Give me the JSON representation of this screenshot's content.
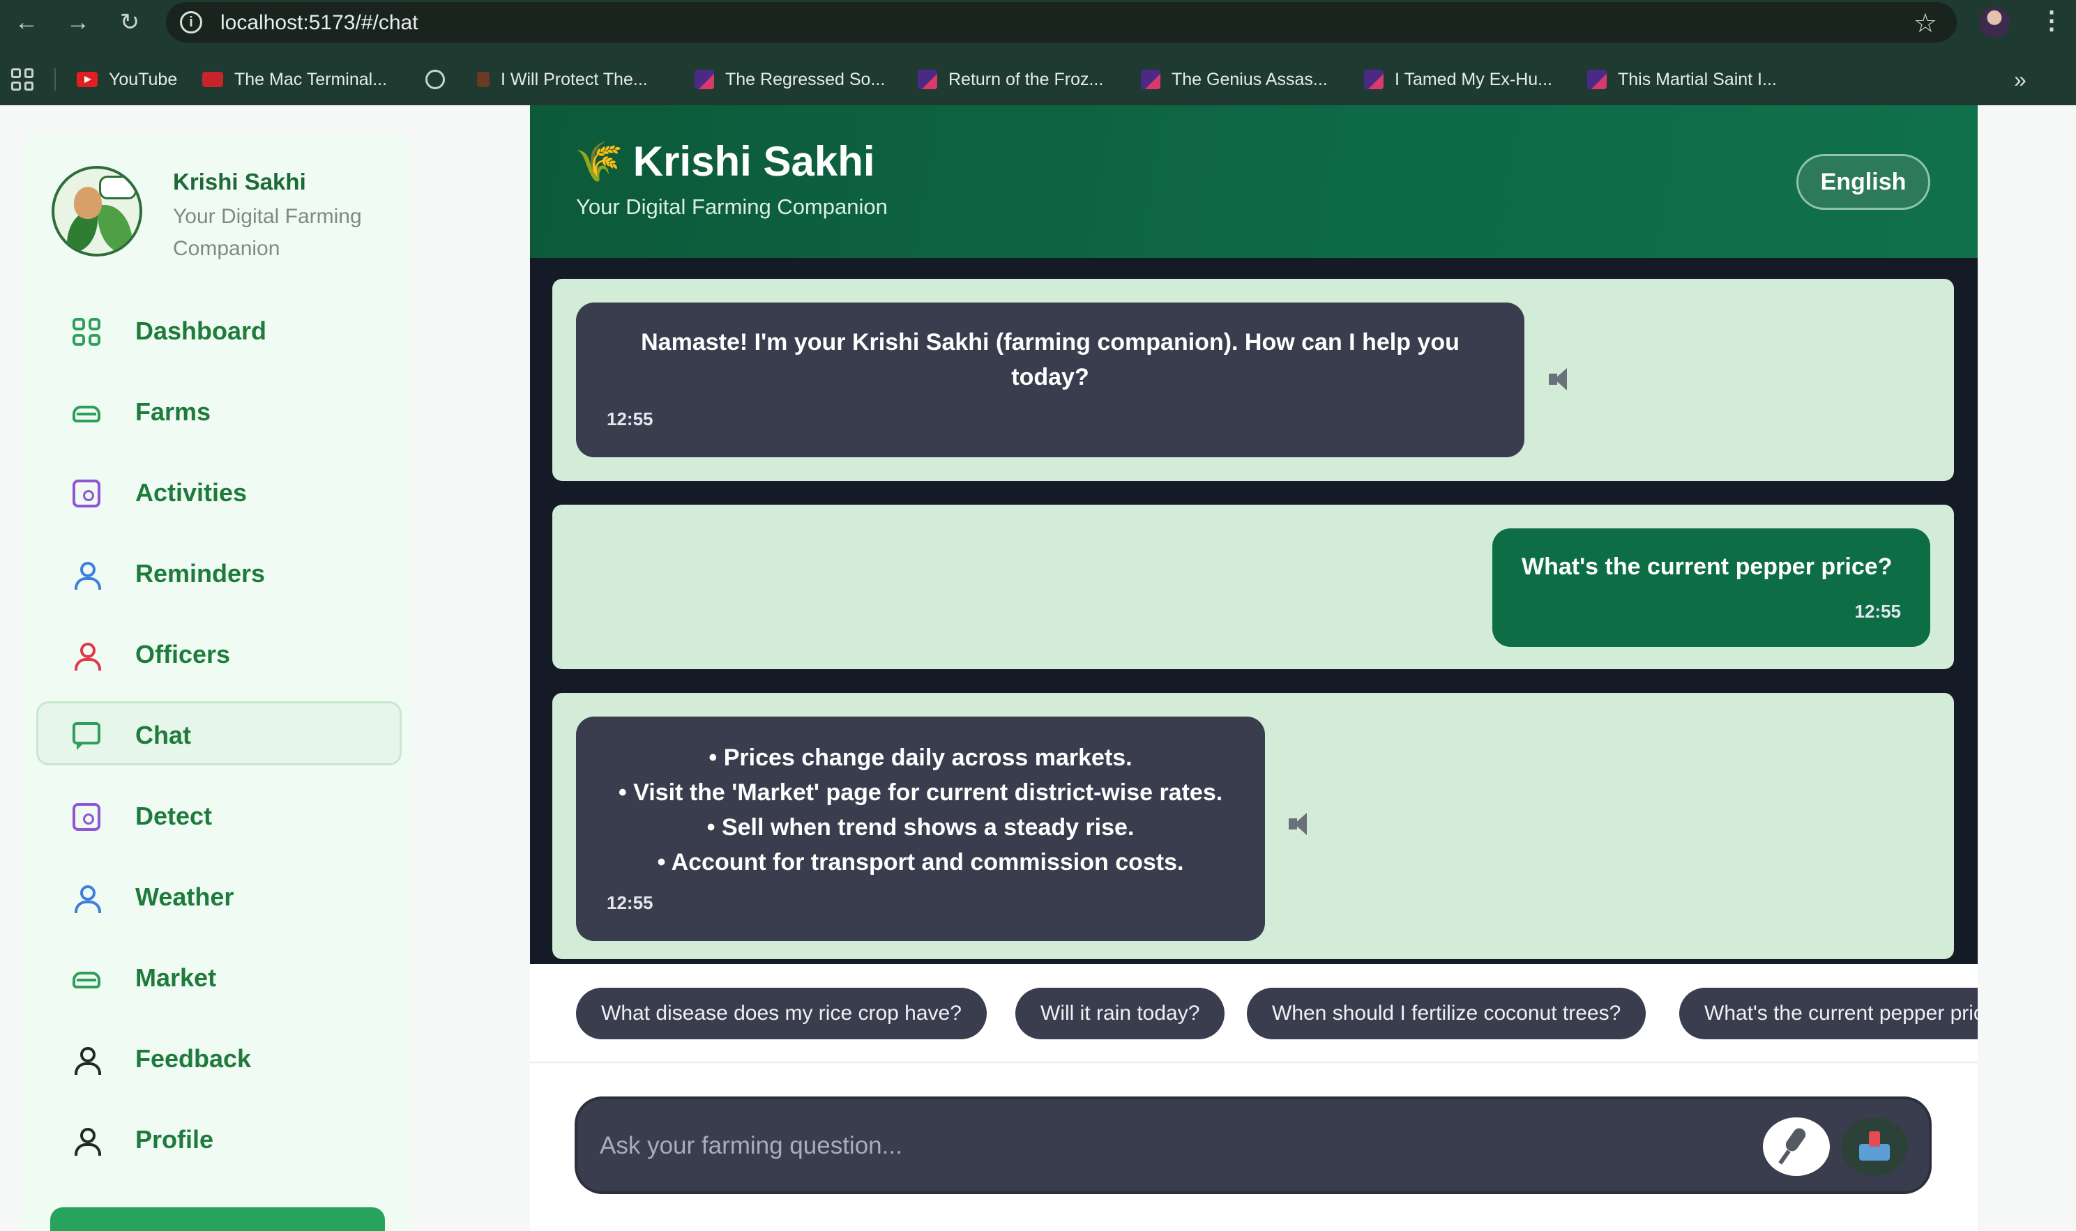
{
  "browser": {
    "url": "localhost:5173/#/chat",
    "nav_back": "←",
    "nav_forward": "→",
    "nav_reload": "↻",
    "star_glyph": "☆",
    "menu_glyph": "⋮",
    "more_glyph": "»",
    "bookmarks": [
      {
        "label": "YouTube",
        "icon": "youtube-icon"
      },
      {
        "label": "The Mac Terminal...",
        "icon": "hlo-icon"
      },
      {
        "label": "",
        "icon": "globe-icon"
      },
      {
        "label": "I Will Protect The...",
        "icon": "fire-icon"
      },
      {
        "label": "The Regressed So...",
        "icon": "book-icon"
      },
      {
        "label": "Return of the Froz...",
        "icon": "book-icon"
      },
      {
        "label": "The Genius Assas...",
        "icon": "book-icon"
      },
      {
        "label": "I Tamed My Ex-Hu...",
        "icon": "book-icon"
      },
      {
        "label": "This Martial Saint I...",
        "icon": "book-icon"
      }
    ]
  },
  "sidebar": {
    "brand_name": "Krishi Sakhi",
    "brand_tagline": "Your Digital Farming Companion",
    "active": "Chat",
    "items": [
      {
        "label": "Dashboard",
        "icon": "dashboard-grid-icon"
      },
      {
        "label": "Farms",
        "icon": "tray-icon"
      },
      {
        "label": "Activities",
        "icon": "activity-box-icon"
      },
      {
        "label": "Reminders",
        "icon": "person-icon"
      },
      {
        "label": "Officers",
        "icon": "person-icon"
      },
      {
        "label": "Chat",
        "icon": "chat-bubble-icon"
      },
      {
        "label": "Detect",
        "icon": "detect-box-icon"
      },
      {
        "label": "Weather",
        "icon": "person-icon"
      },
      {
        "label": "Market",
        "icon": "tray-icon"
      },
      {
        "label": "Feedback",
        "icon": "person-icon"
      },
      {
        "label": "Profile",
        "icon": "person-icon"
      }
    ]
  },
  "header": {
    "icon": "wheat-icon",
    "wheat_glyph": "🌾",
    "title": "Krishi Sakhi",
    "subtitle": "Your Digital Farming Companion",
    "language": "English"
  },
  "messages": [
    {
      "sender": "bot",
      "text": "Namaste! I'm your Krishi Sakhi (farming companion). How can I help you today?",
      "time": "12:55"
    },
    {
      "sender": "user",
      "text": "What's the current pepper price?",
      "time": "12:55"
    },
    {
      "sender": "bot",
      "lines": [
        "• Prices change daily across markets.",
        "• Visit the 'Market' page for current district-wise rates.",
        "• Sell when trend shows a steady rise.",
        "• Account for transport and commission costs."
      ],
      "time": "12:55"
    }
  ],
  "suggestions": [
    "What disease does my rice crop have?",
    "Will it rain today?",
    "When should I fertilize coconut trees?",
    "What's the current pepper price?"
  ],
  "input": {
    "placeholder": "Ask your farming question..."
  },
  "colors": {
    "brand_green": "#0d6e46",
    "bot_bubble": "#3a3d4e",
    "chat_row_bg": "#d3ecd8",
    "sidebar_text": "#1e7b3c"
  }
}
